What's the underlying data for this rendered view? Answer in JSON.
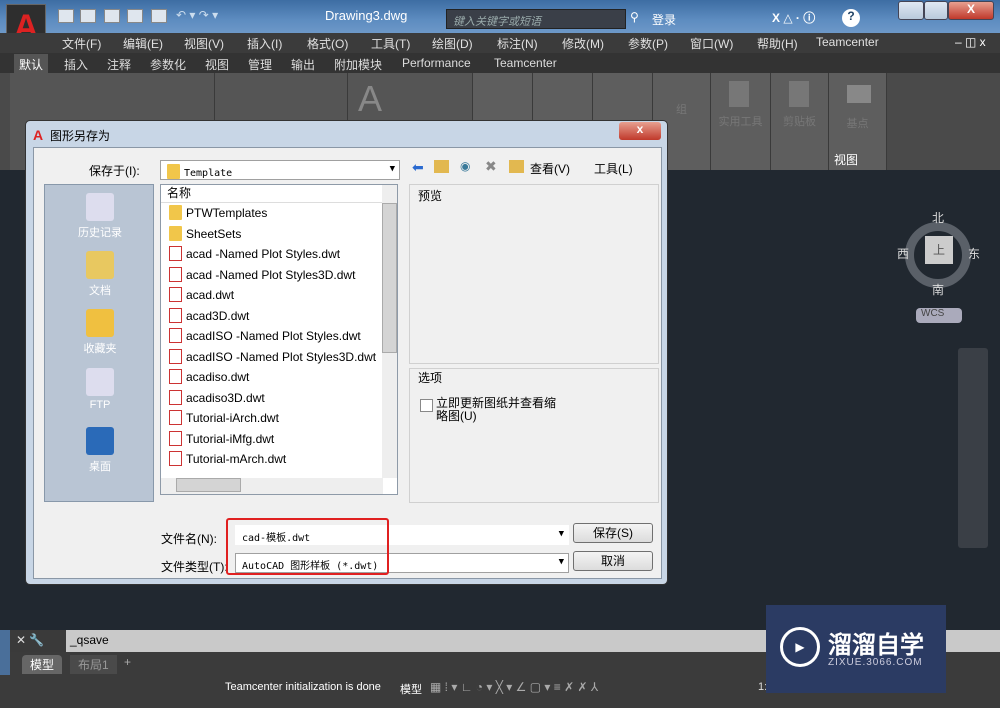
{
  "app": {
    "logo": "A",
    "document_title": "Drawing3.dwg",
    "search_placeholder": "键入关键字或短语",
    "login": "登录",
    "extra_title_item": "Teamcenter"
  },
  "menu": [
    "文件(F)",
    "编辑(E)",
    "视图(V)",
    "插入(I)",
    "格式(O)",
    "工具(T)",
    "绘图(D)",
    "标注(N)",
    "修改(M)",
    "参数(P)",
    "窗口(W)",
    "帮助(H)",
    "Teamcenter"
  ],
  "ribbon_tabs": [
    "默认",
    "插入",
    "注释",
    "参数化",
    "视图",
    "管理",
    "输出",
    "附加模块",
    "Performance",
    "Teamcenter"
  ],
  "ribbon_panels": {
    "group": "组",
    "utilities": "实用工具",
    "clipboard": "剪贴板",
    "base": "基点",
    "view": "视图"
  },
  "viewcube": {
    "north": "北",
    "south": "南",
    "east": "东",
    "west": "西",
    "face": "上",
    "wcs": "WCS"
  },
  "dialog": {
    "title": "图形另存为",
    "save_in_label": "保存于(I):",
    "save_in_value": "Template",
    "toolbar": {
      "view": "查看(V)",
      "tools": "工具(L)"
    },
    "places": [
      "历史记录",
      "文档",
      "收藏夹",
      "FTP",
      "桌面"
    ],
    "column_header": "名称",
    "files": [
      {
        "name": "PTWTemplates",
        "type": "folder"
      },
      {
        "name": "SheetSets",
        "type": "folder"
      },
      {
        "name": "acad -Named Plot Styles.dwt",
        "type": "dwt"
      },
      {
        "name": "acad -Named Plot Styles3D.dwt",
        "type": "dwt"
      },
      {
        "name": "acad.dwt",
        "type": "dwt"
      },
      {
        "name": "acad3D.dwt",
        "type": "dwt"
      },
      {
        "name": "acadISO -Named Plot Styles.dwt",
        "type": "dwt"
      },
      {
        "name": "acadISO -Named Plot Styles3D.dwt",
        "type": "dwt"
      },
      {
        "name": "acadiso.dwt",
        "type": "dwt"
      },
      {
        "name": "acadiso3D.dwt",
        "type": "dwt"
      },
      {
        "name": "Tutorial-iArch.dwt",
        "type": "dwt"
      },
      {
        "name": "Tutorial-iMfg.dwt",
        "type": "dwt"
      },
      {
        "name": "Tutorial-mArch.dwt",
        "type": "dwt"
      }
    ],
    "preview_label": "预览",
    "options_label": "选项",
    "checkbox_label": "立即更新图纸并查看缩略图(U)",
    "checkbox_checked": false,
    "filename_label": "文件名(N):",
    "filename_value": "cad-模板.dwt",
    "filetype_label": "文件类型(T):",
    "filetype_value": "AutoCAD 图形样板 (*.dwt)",
    "save_button": "保存(S)",
    "cancel_button": "取消",
    "highlight_color": "#e02020"
  },
  "command_line": {
    "text": "_qsave"
  },
  "layout_tabs": [
    "模型",
    "布局1",
    "+"
  ],
  "status": {
    "message": "Teamcenter initialization is done",
    "model": "模型",
    "scale": "1:1"
  },
  "watermark": {
    "name": "溜溜自学",
    "url": "ZIXUE.3066.COM"
  }
}
